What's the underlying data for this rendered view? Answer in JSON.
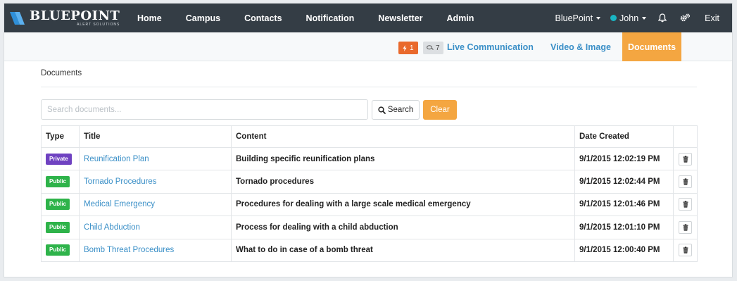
{
  "navbar": {
    "brand_name": "BLUEPOINT",
    "brand_sub": "ALERT SOLUTIONS",
    "links": [
      "Home",
      "Campus",
      "Contacts",
      "Notification",
      "Newsletter",
      "Admin"
    ],
    "org_menu": "BluePoint",
    "user_menu": "John",
    "user_status_color": "#19b5c3",
    "bell_icon": "bell-icon",
    "settings_icon": "gears-icon",
    "exit": "Exit"
  },
  "subnav": {
    "alert_count": "1",
    "message_count": "7",
    "tabs": [
      "Live Communication",
      "Video & Image",
      "Documents"
    ],
    "active_tab": "Documents",
    "accent_color": "#f4a641"
  },
  "page": {
    "section_title": "Documents",
    "search_placeholder": "Search documents...",
    "search_label": "Search",
    "clear_label": "Clear"
  },
  "table": {
    "headers": [
      "Type",
      "Title",
      "Content",
      "Date Created",
      ""
    ],
    "rows": [
      {
        "type": "Private",
        "type_color": "#6f42c1",
        "title": "Reunification Plan",
        "content": "Building specific reunification plans",
        "date": "9/1/2015 12:02:19 PM"
      },
      {
        "type": "Public",
        "type_color": "#2eb34a",
        "title": "Tornado Procedures",
        "content": "Tornado procedures",
        "date": "9/1/2015 12:02:44 PM"
      },
      {
        "type": "Public",
        "type_color": "#2eb34a",
        "title": "Medical Emergency",
        "content": "Procedures for dealing with a large scale medical emergency",
        "date": "9/1/2015 12:01:46 PM"
      },
      {
        "type": "Public",
        "type_color": "#2eb34a",
        "title": "Child Abduction",
        "content": "Process for dealing with a child abduction",
        "date": "9/1/2015 12:01:10 PM"
      },
      {
        "type": "Public",
        "type_color": "#2eb34a",
        "title": "Bomb Threat Procedures",
        "content": "What to do in case of a bomb threat",
        "date": "9/1/2015 12:00:40 PM"
      }
    ]
  }
}
